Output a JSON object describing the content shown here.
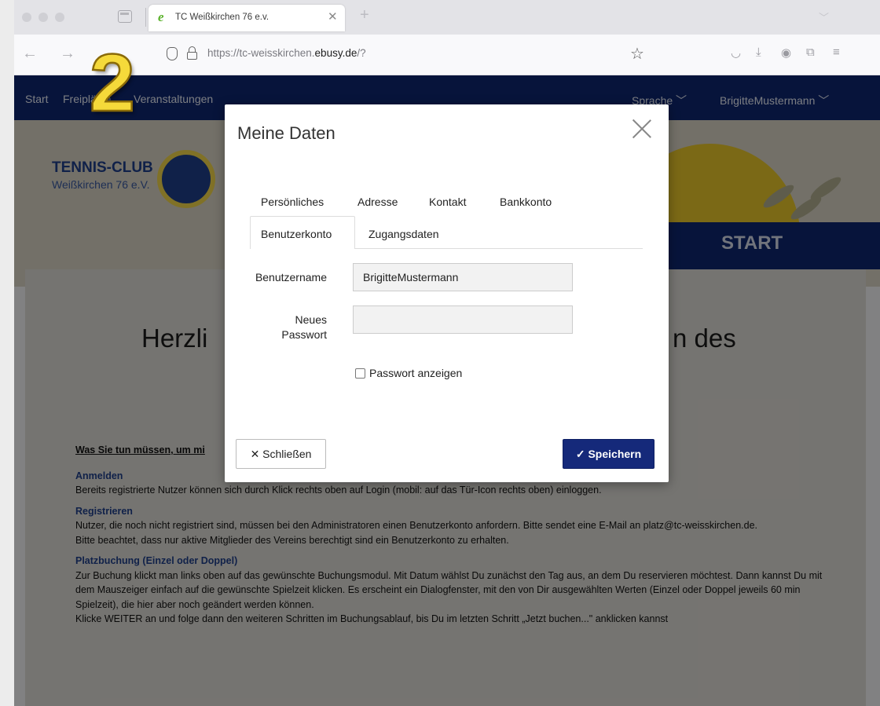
{
  "browser": {
    "tab_title": "TC Weißkirchen 76 e.v.",
    "favicon": "e",
    "url_prefix": "https://tc-weisskirchen.",
    "url_domain": "ebusy.de",
    "url_suffix": "/?"
  },
  "step_number": "2",
  "site_nav": {
    "start": "Start",
    "free_courts": "Freiplätze",
    "events": "Veranstaltungen",
    "language": "Sprache ﹀",
    "user": "BrigitteMustermann ﹀"
  },
  "header": {
    "logo_title": "TENNIS-CLUB",
    "logo_subtitle": "Weißkirchen 76 e.V.",
    "start_banner": "START"
  },
  "welcome": {
    "left_fragment": "Herzli",
    "right_fragment": "n des"
  },
  "article": {
    "intro_link": "Was Sie tun müssen, um mi",
    "sections": [
      {
        "heading": "Anmelden",
        "lines": [
          "Bereits registrierte Nutzer können sich durch Klick rechts oben auf Login (mobil: auf das Tür-Icon rechts oben) einloggen."
        ]
      },
      {
        "heading": "Registrieren",
        "lines": [
          "Nutzer, die noch nicht registriert sind, müssen bei den Administratoren einen Benutzerkonto anfordern. Bitte sendet eine E-Mail an platz@tc-weisskirchen.de.",
          "Bitte beachtet, dass nur aktive Mitglieder des Vereins berechtigt sind ein Benutzerkonto zu erhalten."
        ]
      },
      {
        "heading": "Platzbuchung (Einzel oder Doppel)",
        "lines": [
          "Zur Buchung klickt man links oben auf das gewünschte Buchungsmodul. Mit Datum wählst Du zunächst den Tag aus, an dem Du reservieren möchtest. Dann kannst Du mit dem Mauszeiger einfach auf die gewünschte Spielzeit klicken. Es erscheint ein Dialogfenster, mit den von Dir ausgewählten Werten (Einzel oder Doppel jeweils 60 min Spielzeit), die hier aber noch geändert werden können.",
          "Klicke WEITER an und folge dann den weiteren  Schritten im Buchungsablauf, bis Du im letzten Schritt „Jetzt buchen...\" anklicken kannst"
        ]
      }
    ]
  },
  "modal": {
    "title": "Meine Daten",
    "tabs_row1": [
      "Persönliches",
      "Adresse",
      "Kontakt",
      "Bankkonto"
    ],
    "tabs_row2": [
      "Benutzerkonto",
      "Zugangsdaten"
    ],
    "active_tab": "Benutzerkonto",
    "username_label": "Benutzername",
    "username_value": "BrigitteMustermann",
    "password_label_line1": "Neues",
    "password_label_line2": "Passwort",
    "password_value": "",
    "show_password_label": "Passwort anzeigen",
    "show_password_checked": false,
    "close_button": "✕ Schließen",
    "save_button": "✓ Speichern"
  },
  "colors": {
    "site_nav": "#0e2670",
    "save_button": "#15297a",
    "step_badge": "#f5d93a"
  }
}
